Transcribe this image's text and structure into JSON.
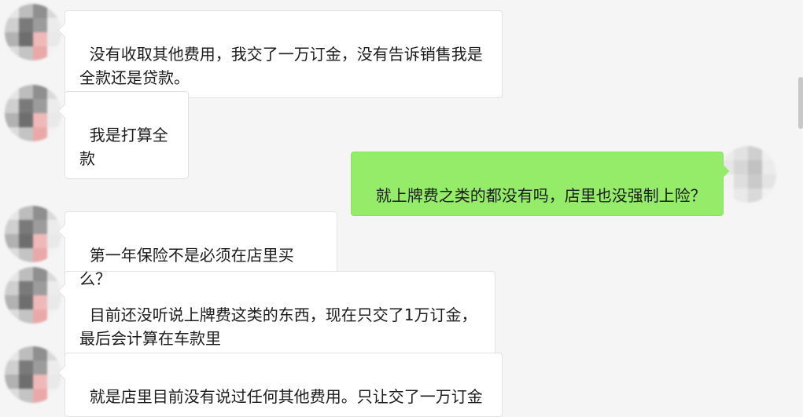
{
  "messages": [
    {
      "side": "left",
      "text": "没有收取其他费用，我交了一万订金，没有告诉销售我是\n全款还是贷款。"
    },
    {
      "side": "left",
      "text": "我是打算全款"
    },
    {
      "side": "right",
      "text": "就上牌费之类的都没有吗，店里也没强制上险？"
    },
    {
      "side": "left",
      "text": "第一年保险不是必须在店里买么？"
    },
    {
      "side": "left",
      "text": "目前还没听说上牌费这类的东西，现在只交了1万订金，\n最后会计算在车款里"
    },
    {
      "side": "left",
      "text": "就是店里目前没有说过任何其他费用。只让交了一万订金"
    }
  ],
  "avatar_colors": {
    "contact": [
      "#e6e6e6",
      "#bdbdbd",
      "#8f8f8f",
      "#d9d9d9",
      "#cfcfcf",
      "#7a7a7a",
      "#9c9c9c",
      "#ececec",
      "#b2b2b2",
      "#6e6e6e",
      "#f0b9b9",
      "#e9e9e9",
      "#dcdcdc",
      "#c4c4c4",
      "#eaa9a9",
      "#f2f2f2"
    ],
    "self": [
      "#ececec",
      "#e2e2e2",
      "#cfcfcf",
      "#efefef",
      "#e6e6e6",
      "#d6d6d6",
      "#c2c2c2",
      "#ebebeb",
      "#f2f2f2",
      "#dedede",
      "#cacaca",
      "#e4e4e4",
      "#f4f4f4",
      "#e9e9e9",
      "#d9d9d9",
      "#f1f1f1"
    ]
  }
}
